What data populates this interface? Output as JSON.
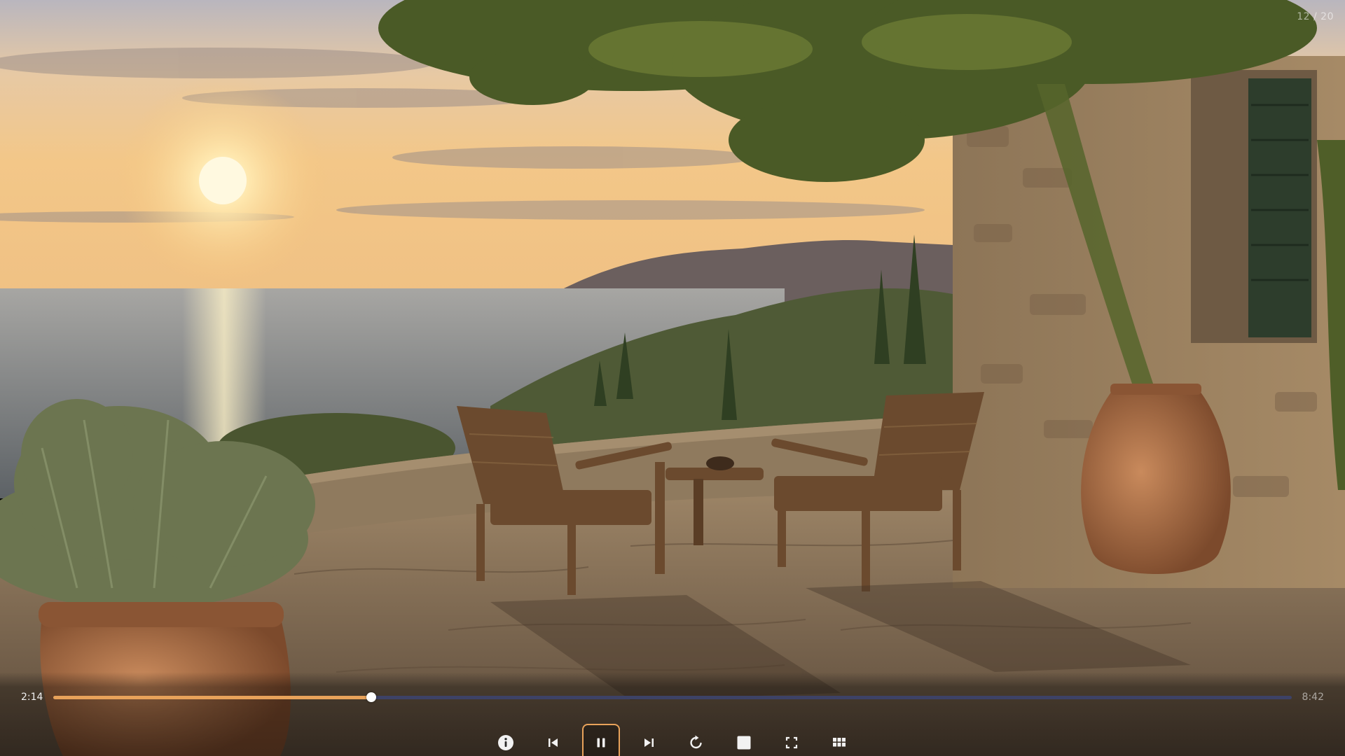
{
  "viewer": {
    "counter": "12 / 20"
  },
  "player": {
    "current_time": "2:14",
    "total_time": "8:42",
    "progress": 0.2567,
    "accent_color": "#e8a25a",
    "track_color": "#3d4266"
  },
  "controls": [
    {
      "name": "info-icon",
      "state": "normal"
    },
    {
      "name": "previous-icon",
      "state": "normal"
    },
    {
      "name": "pause-icon",
      "state": "focused"
    },
    {
      "name": "next-icon",
      "state": "normal"
    },
    {
      "name": "rotate-icon",
      "state": "normal"
    },
    {
      "name": "stop-icon",
      "state": "normal"
    },
    {
      "name": "fullscreen-icon",
      "state": "normal"
    },
    {
      "name": "grid-icon",
      "state": "normal"
    }
  ]
}
